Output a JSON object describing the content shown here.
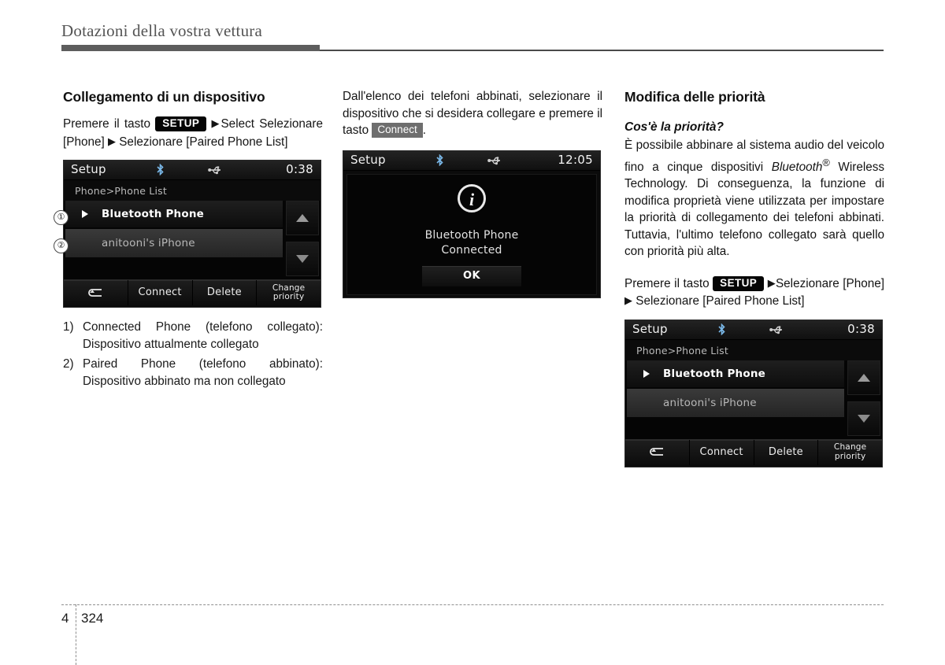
{
  "header": {
    "title": "Dotazioni della vostra vettura"
  },
  "footer": {
    "chapter": "4",
    "page": "324"
  },
  "col1": {
    "section_title": "Collegamento di un dispositivo",
    "instruction_pre": "Premere il tasto",
    "key_setup": "SETUP",
    "arrow": "▶",
    "instruction_post_1": "Select",
    "instruction_post_2": "Selezionare [Phone]",
    "instruction_post_3": "Selezionare [Paired Phone List]",
    "callout_1": "①",
    "callout_2": "②",
    "list": [
      {
        "marker": "1)",
        "text": "Connected Phone (telefono collegato): Dispositivo attualmente collegato"
      },
      {
        "marker": "2)",
        "text": "Paired Phone (telefono abbinato): Dispositivo abbinato ma non collegato"
      }
    ]
  },
  "col2": {
    "paragraph_pre": "Dall'elenco dei telefoni abbinati, selezionare il dispositivo che si desidera collegare e premere il tasto",
    "key_connect": "Connect",
    "paragraph_post": "."
  },
  "col3": {
    "section_title": "Modifica delle priorità",
    "sub_title": "Cos'è la priorità?",
    "body_1": "È possibile abbinare al sistema audio del veicolo fino a cinque dispositivi",
    "body_italic": "Bluetooth",
    "body_sup": "®",
    "body_2": "Wireless Technology. Di conseguenza, la funzione di modifica proprietà viene utilizzata per impostare la priorità di collegamento dei telefoni abbinati. Tuttavia, l'ultimo telefono collegato sarà quello con priorità più alta.",
    "instruction_pre": "Premere il tasto",
    "key_setup": "SETUP",
    "arrow": "▶",
    "instruction_post_1": "Selezionare [Phone]",
    "instruction_post_2": "Selezionare [Paired Phone List]"
  },
  "screen_phone_list": {
    "status_title": "Setup",
    "clock": "0:38",
    "bluetooth_icon": "bluetooth-icon",
    "usb_icon": "usb-icon",
    "breadcrumb": "Phone>Phone List",
    "rows": [
      {
        "label": "Bluetooth Phone",
        "state": "connected"
      },
      {
        "label": "anitooni's iPhone",
        "state": "paired"
      }
    ],
    "scroll_up_icon": "triangle-up-icon",
    "scroll_down_icon": "triangle-down-icon",
    "toolbar": [
      {
        "label": "",
        "icon": "back-arrow-icon"
      },
      {
        "label": "Connect",
        "icon": ""
      },
      {
        "label": "Delete",
        "icon": ""
      },
      {
        "label": "Change priority",
        "label_line1": "Change",
        "label_line2": "priority",
        "icon": ""
      }
    ]
  },
  "screen_phone_list_2": {
    "status_title": "Setup",
    "clock": "0:38",
    "breadcrumb": "Phone>Phone List",
    "rows": [
      {
        "label": "Bluetooth Phone",
        "state": "connected"
      },
      {
        "label": "anitooni's iPhone",
        "state": "paired"
      }
    ],
    "toolbar": [
      {
        "label": "",
        "icon": "back-arrow-icon"
      },
      {
        "label": "Connect",
        "icon": ""
      },
      {
        "label": "Delete",
        "icon": ""
      },
      {
        "label_line1": "Change",
        "label_line2": "priority",
        "icon": ""
      }
    ]
  },
  "screen_connected_popup": {
    "status_title": "Setup",
    "clock": "12:05",
    "info_icon": "info-icon",
    "message_line1": "Bluetooth Phone",
    "message_line2": "Connected",
    "ok_label": "OK"
  }
}
